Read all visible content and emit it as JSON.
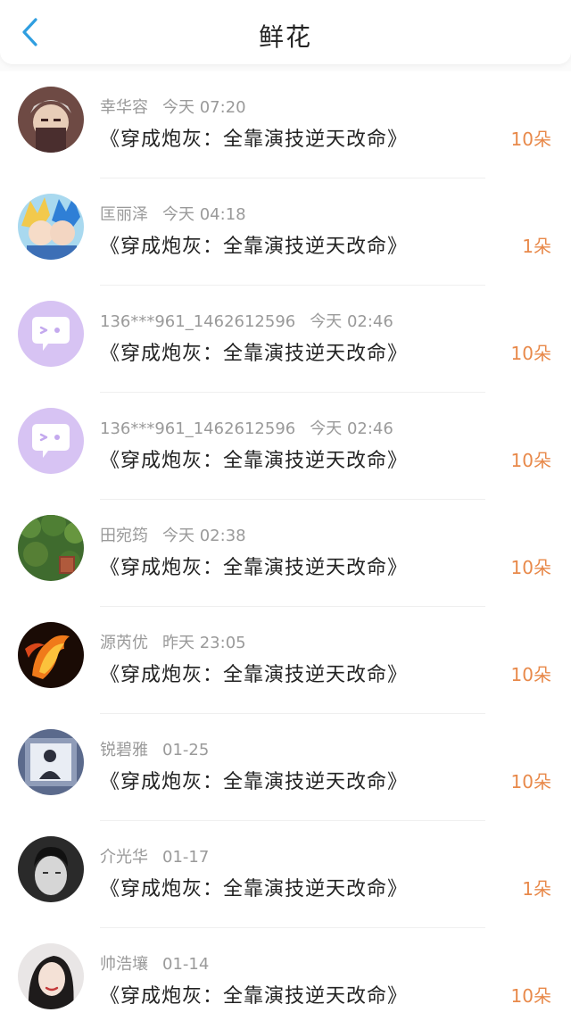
{
  "header": {
    "title": "鲜花"
  },
  "colors": {
    "accent": "#2f9ee0",
    "count": "#e8894a"
  },
  "rows": [
    {
      "name": "幸华容",
      "time": "今天 07:20",
      "book": "《穿成炮灰：全靠演技逆天改命》",
      "count": "10朵",
      "avatar": "anime-man-avatar"
    },
    {
      "name": "匡丽泽",
      "time": "今天 04:18",
      "book": "《穿成炮灰：全靠演技逆天改命》",
      "count": "1朵",
      "avatar": "anime-couple-avatar"
    },
    {
      "name": "136***961_1462612596",
      "time": "今天 02:46",
      "book": "《穿成炮灰：全靠演技逆天改命》",
      "count": "10朵",
      "avatar": "default-chat-avatar"
    },
    {
      "name": "136***961_1462612596",
      "time": "今天 02:46",
      "book": "《穿成炮灰：全靠演技逆天改命》",
      "count": "10朵",
      "avatar": "default-chat-avatar"
    },
    {
      "name": "田宛筠",
      "time": "今天 02:38",
      "book": "《穿成炮灰：全靠演技逆天改命》",
      "count": "10朵",
      "avatar": "ivy-wall-avatar"
    },
    {
      "name": "源芮优",
      "time": "昨天 23:05",
      "book": "《穿成炮灰：全靠演技逆天改命》",
      "count": "10朵",
      "avatar": "fire-horse-avatar"
    },
    {
      "name": "锐碧雅",
      "time": "01-25",
      "book": "《穿成炮灰：全靠演技逆天改命》",
      "count": "10朵",
      "avatar": "photo-collage-avatar"
    },
    {
      "name": "介光华",
      "time": "01-17",
      "book": "《穿成炮灰：全靠演技逆天改命》",
      "count": "1朵",
      "avatar": "man-portrait-avatar"
    },
    {
      "name": "帅浩壤",
      "time": "01-14",
      "book": "《穿成炮灰：全靠演技逆天改命》",
      "count": "10朵",
      "avatar": "woman-portrait-avatar"
    }
  ]
}
